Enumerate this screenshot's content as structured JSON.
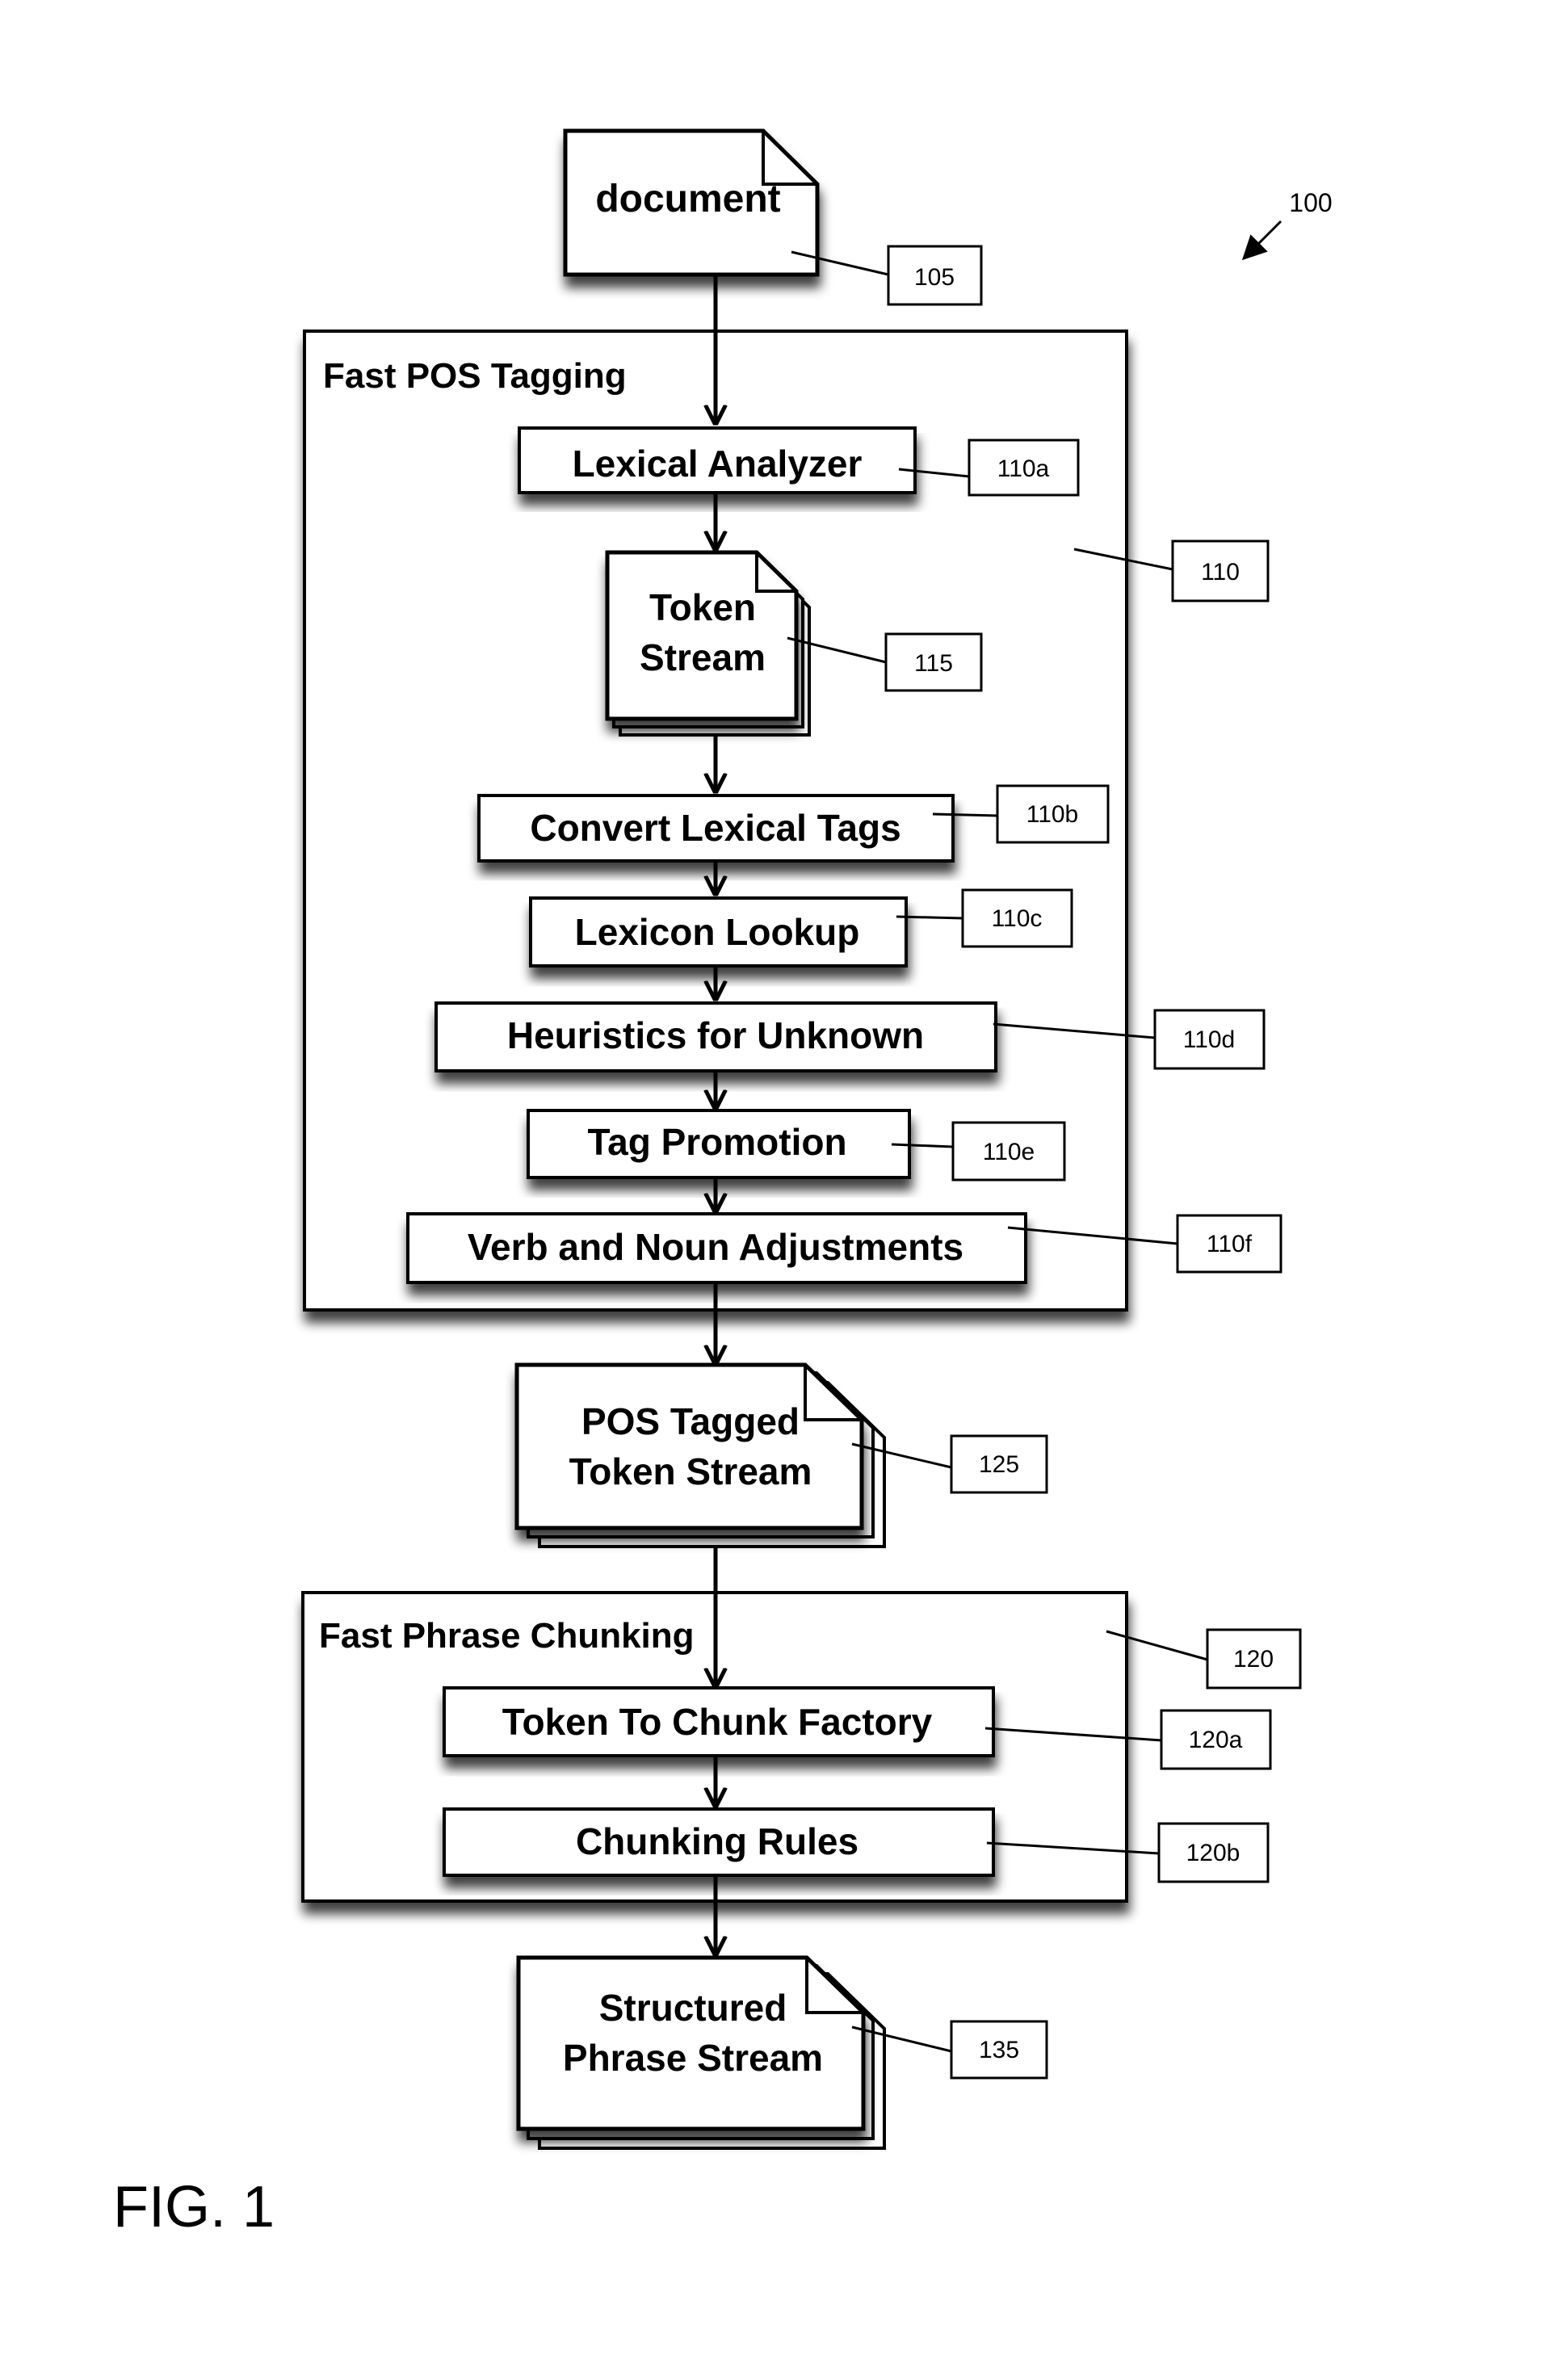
{
  "figure": {
    "label": "FIG. 1",
    "reference": "100"
  },
  "nodes": {
    "document": {
      "lines": [
        "document"
      ],
      "ref": "105"
    },
    "fast_pos_tagging": {
      "title": "Fast POS Tagging",
      "ref": "110"
    },
    "lexical_analyzer": {
      "label": "Lexical Analyzer",
      "ref": "110a"
    },
    "token_stream": {
      "lines": [
        "Token",
        "Stream"
      ],
      "ref": "115"
    },
    "convert_lexical_tags": {
      "label": "Convert Lexical Tags",
      "ref": "110b"
    },
    "lexicon_lookup": {
      "label": "Lexicon Lookup",
      "ref": "110c"
    },
    "heuristics_for_unknown": {
      "label": "Heuristics for Unknown",
      "ref": "110d"
    },
    "tag_promotion": {
      "label": "Tag Promotion",
      "ref": "110e"
    },
    "verb_and_noun_adjustments": {
      "label": "Verb and Noun Adjustments",
      "ref": "110f"
    },
    "pos_tagged_token_stream": {
      "lines": [
        "POS Tagged",
        "Token Stream"
      ],
      "ref": "125"
    },
    "fast_phrase_chunking": {
      "title": "Fast Phrase Chunking",
      "ref": "120"
    },
    "token_to_chunk_factory": {
      "label": "Token To Chunk Factory",
      "ref": "120a"
    },
    "chunking_rules": {
      "label": "Chunking Rules",
      "ref": "120b"
    },
    "structured_phrase_stream": {
      "lines": [
        "Structured",
        "Phrase Stream"
      ],
      "ref": "135"
    }
  }
}
